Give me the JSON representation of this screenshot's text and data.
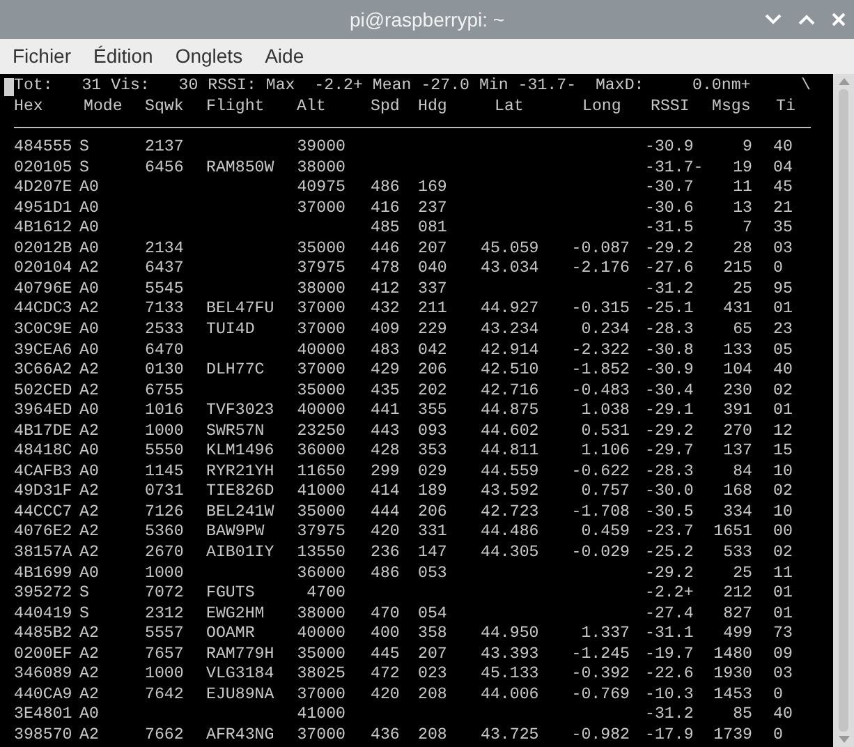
{
  "window": {
    "title": "pi@raspberrypi: ~"
  },
  "menu": [
    "Fichier",
    "Édition",
    "Onglets",
    "Aide"
  ],
  "terminal": {
    "status_line": "Tot:   31 Vis:   30 RSSI: Max  -2.2+ Mean -27.0 Min -31.7-  MaxD:     0.0nm+",
    "spinner": "\\",
    "columns": [
      "Hex",
      "Mode",
      "Sqwk",
      "Flight",
      "Alt",
      "Spd",
      "Hdg",
      "Lat",
      "Long",
      "RSSI",
      "Msgs",
      "Ti"
    ],
    "rows": [
      {
        "hex": "484555",
        "mode": "S",
        "sqwk": "2137",
        "alt": "39000",
        "rssi": "-30.9",
        "msgs": "9",
        "ti": "40"
      },
      {
        "hex": "020105",
        "mode": "S",
        "sqwk": "6456",
        "flight": "RAM850W",
        "alt": "38000",
        "rssi": "-31.7-",
        "msgs": "19",
        "ti": "04"
      },
      {
        "hex": "4D207E",
        "mode": "A0",
        "alt": "40975",
        "spd": "486",
        "hdg": "169",
        "rssi": "-30.7",
        "msgs": "11",
        "ti": "45"
      },
      {
        "hex": "4951D1",
        "mode": "A0",
        "alt": "37000",
        "spd": "416",
        "hdg": "237",
        "rssi": "-30.6",
        "msgs": "13",
        "ti": "21"
      },
      {
        "hex": "4B1612",
        "mode": "A0",
        "spd": "485",
        "hdg": "081",
        "rssi": "-31.5",
        "msgs": "7",
        "ti": "35"
      },
      {
        "hex": "02012B",
        "mode": "A0",
        "sqwk": "2134",
        "alt": "35000",
        "spd": "446",
        "hdg": "207",
        "lat": "45.059",
        "long": "-0.087",
        "rssi": "-29.2",
        "msgs": "28",
        "ti": "03"
      },
      {
        "hex": "020104",
        "mode": "A2",
        "sqwk": "6437",
        "alt": "37975",
        "spd": "478",
        "hdg": "040",
        "lat": "43.034",
        "long": "-2.176",
        "rssi": "-27.6",
        "msgs": "215",
        "ti": "0"
      },
      {
        "hex": "40796E",
        "mode": "A0",
        "sqwk": "5545",
        "alt": "38000",
        "spd": "412",
        "hdg": "337",
        "rssi": "-31.2",
        "msgs": "25",
        "ti": "95"
      },
      {
        "hex": "44CDC3",
        "mode": "A2",
        "sqwk": "7133",
        "flight": "BEL47FU",
        "alt": "37000",
        "spd": "432",
        "hdg": "211",
        "lat": "44.927",
        "long": "-0.315",
        "rssi": "-25.1",
        "msgs": "431",
        "ti": "01"
      },
      {
        "hex": "3C0C9E",
        "mode": "A0",
        "sqwk": "2533",
        "flight": "TUI4D",
        "alt": "37000",
        "spd": "409",
        "hdg": "229",
        "lat": "43.234",
        "long": "0.234",
        "rssi": "-28.3",
        "msgs": "65",
        "ti": "23"
      },
      {
        "hex": "39CEA6",
        "mode": "A0",
        "sqwk": "6470",
        "alt": "40000",
        "spd": "483",
        "hdg": "042",
        "lat": "42.914",
        "long": "-2.322",
        "rssi": "-30.8",
        "msgs": "133",
        "ti": "05"
      },
      {
        "hex": "3C66A2",
        "mode": "A2",
        "sqwk": "0130",
        "flight": "DLH77C",
        "alt": "37000",
        "spd": "429",
        "hdg": "206",
        "lat": "42.510",
        "long": "-1.852",
        "rssi": "-30.9",
        "msgs": "104",
        "ti": "40"
      },
      {
        "hex": "502CED",
        "mode": "A2",
        "sqwk": "6755",
        "alt": "35000",
        "spd": "435",
        "hdg": "202",
        "lat": "42.716",
        "long": "-0.483",
        "rssi": "-30.4",
        "msgs": "230",
        "ti": "02"
      },
      {
        "hex": "3964ED",
        "mode": "A0",
        "sqwk": "1016",
        "flight": "TVF3023",
        "alt": "40000",
        "spd": "441",
        "hdg": "355",
        "lat": "44.875",
        "long": "1.038",
        "rssi": "-29.1",
        "msgs": "391",
        "ti": "01"
      },
      {
        "hex": "4B17DE",
        "mode": "A2",
        "sqwk": "1000",
        "flight": "SWR57N",
        "alt": "23250",
        "spd": "443",
        "hdg": "093",
        "lat": "44.602",
        "long": "0.531",
        "rssi": "-29.2",
        "msgs": "270",
        "ti": "12"
      },
      {
        "hex": "48418C",
        "mode": "A0",
        "sqwk": "5550",
        "flight": "KLM1496",
        "alt": "36000",
        "spd": "428",
        "hdg": "353",
        "lat": "44.811",
        "long": "1.106",
        "rssi": "-29.7",
        "msgs": "137",
        "ti": "15"
      },
      {
        "hex": "4CAFB3",
        "mode": "A0",
        "sqwk": "1145",
        "flight": "RYR21YH",
        "alt": "11650",
        "spd": "299",
        "hdg": "029",
        "lat": "44.559",
        "long": "-0.622",
        "rssi": "-28.3",
        "msgs": "84",
        "ti": "10"
      },
      {
        "hex": "49D31F",
        "mode": "A2",
        "sqwk": "0731",
        "flight": "TIE826D",
        "alt": "41000",
        "spd": "414",
        "hdg": "189",
        "lat": "43.592",
        "long": "0.757",
        "rssi": "-30.0",
        "msgs": "168",
        "ti": "02"
      },
      {
        "hex": "44CCC7",
        "mode": "A2",
        "sqwk": "7126",
        "flight": "BEL241W",
        "alt": "35000",
        "spd": "444",
        "hdg": "206",
        "lat": "42.723",
        "long": "-1.708",
        "rssi": "-30.5",
        "msgs": "334",
        "ti": "10"
      },
      {
        "hex": "4076E2",
        "mode": "A2",
        "sqwk": "5360",
        "flight": "BAW9PW",
        "alt": "37975",
        "spd": "420",
        "hdg": "331",
        "lat": "44.486",
        "long": "0.459",
        "rssi": "-23.7",
        "msgs": "1651",
        "ti": "00"
      },
      {
        "hex": "38157A",
        "mode": "A2",
        "sqwk": "2670",
        "flight": "AIB01IY",
        "alt": "13550",
        "spd": "236",
        "hdg": "147",
        "lat": "44.305",
        "long": "-0.029",
        "rssi": "-25.2",
        "msgs": "533",
        "ti": "02"
      },
      {
        "hex": "4B1699",
        "mode": "A0",
        "sqwk": "1000",
        "alt": "36000",
        "spd": "486",
        "hdg": "053",
        "rssi": "-29.2",
        "msgs": "25",
        "ti": "11"
      },
      {
        "hex": "395272",
        "mode": "S",
        "sqwk": "7072",
        "flight": "FGUTS",
        "alt": "4700",
        "rssi": "-2.2+",
        "msgs": "212",
        "ti": "01"
      },
      {
        "hex": "440419",
        "mode": "S",
        "sqwk": "2312",
        "flight": "EWG2HM",
        "alt": "38000",
        "spd": "470",
        "hdg": "054",
        "rssi": "-27.4",
        "msgs": "827",
        "ti": "01"
      },
      {
        "hex": "4485B2",
        "mode": "A2",
        "sqwk": "5557",
        "flight": "OOAMR",
        "alt": "40000",
        "spd": "400",
        "hdg": "358",
        "lat": "44.950",
        "long": "1.337",
        "rssi": "-31.1",
        "msgs": "499",
        "ti": "73"
      },
      {
        "hex": "0200EF",
        "mode": "A2",
        "sqwk": "7657",
        "flight": "RAM779H",
        "alt": "35000",
        "spd": "445",
        "hdg": "207",
        "lat": "43.393",
        "long": "-1.245",
        "rssi": "-19.7",
        "msgs": "1480",
        "ti": "09"
      },
      {
        "hex": "346089",
        "mode": "A2",
        "sqwk": "1000",
        "flight": "VLG3184",
        "alt": "38025",
        "spd": "472",
        "hdg": "023",
        "lat": "45.133",
        "long": "-0.392",
        "rssi": "-22.6",
        "msgs": "1930",
        "ti": "03"
      },
      {
        "hex": "440CA9",
        "mode": "A2",
        "sqwk": "7642",
        "flight": "EJU89NA",
        "alt": "37000",
        "spd": "420",
        "hdg": "208",
        "lat": "44.006",
        "long": "-0.769",
        "rssi": "-10.3",
        "msgs": "1453",
        "ti": "0"
      },
      {
        "hex": "3E4801",
        "mode": "A0",
        "alt": "41000",
        "rssi": "-31.2",
        "msgs": "85",
        "ti": "40"
      },
      {
        "hex": "398570",
        "mode": "A2",
        "sqwk": "7662",
        "flight": "AFR43NG",
        "alt": "37000",
        "spd": "436",
        "hdg": "208",
        "lat": "43.725",
        "long": "-0.982",
        "rssi": "-17.9",
        "msgs": "1739",
        "ti": "0"
      }
    ]
  }
}
